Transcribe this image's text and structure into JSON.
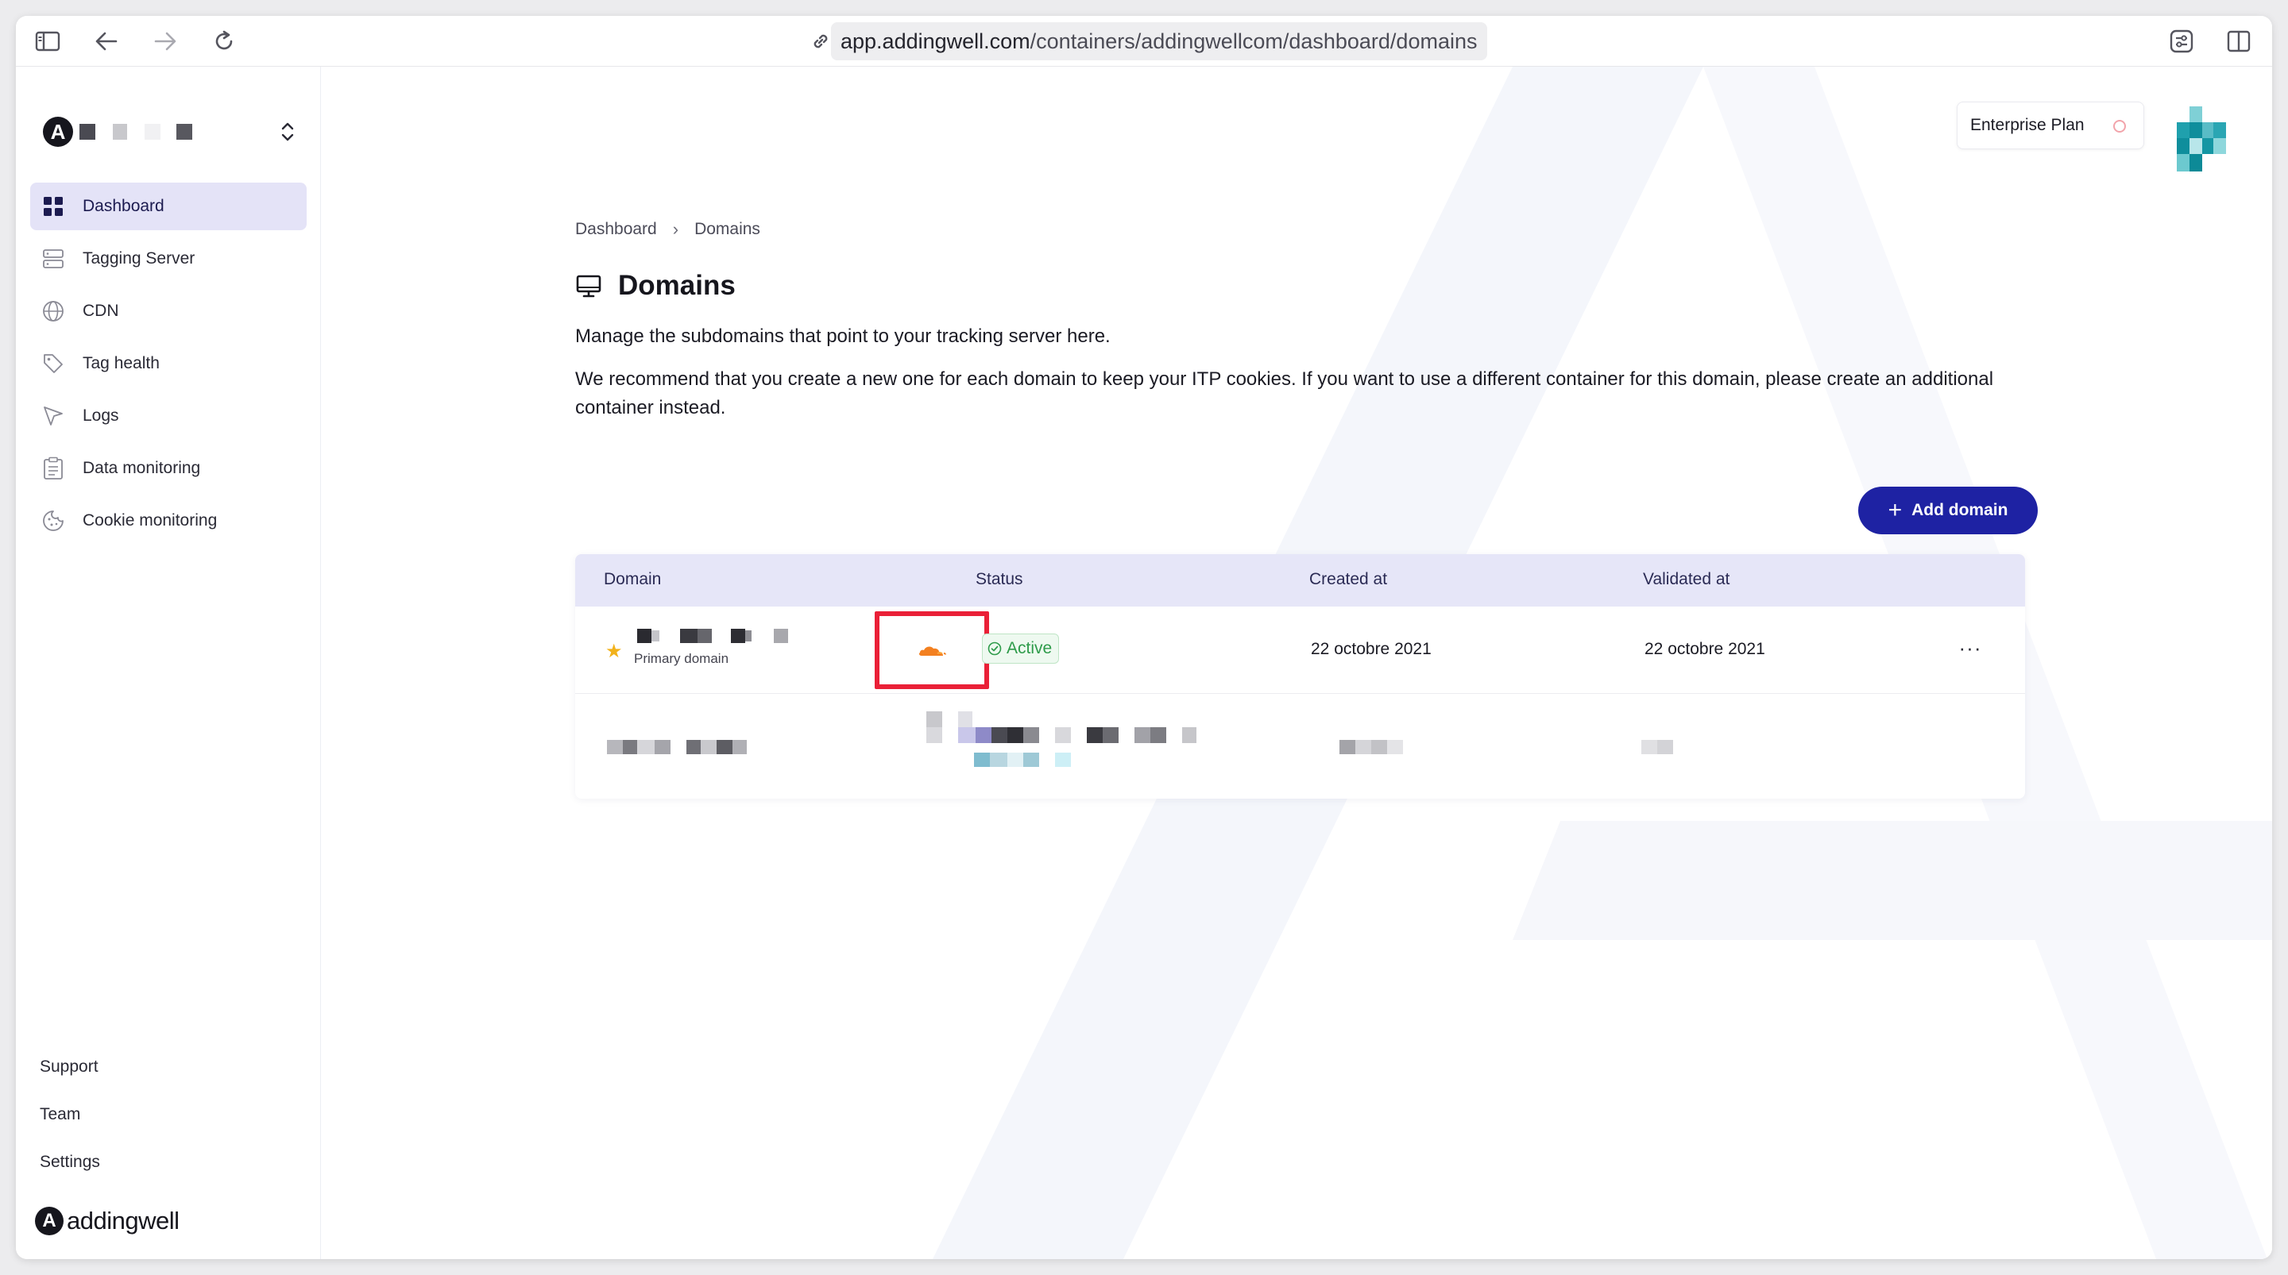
{
  "browser": {
    "url_host": "app.addingwell.com",
    "url_path": "/containers/addingwellcom/dashboard/domains"
  },
  "sidebar": {
    "items": [
      {
        "label": "Dashboard",
        "icon": "dashboard-grid-icon",
        "active": true
      },
      {
        "label": "Tagging Server",
        "icon": "server-icon",
        "active": false
      },
      {
        "label": "CDN",
        "icon": "globe-icon",
        "active": false
      },
      {
        "label": "Tag health",
        "icon": "tag-icon",
        "active": false
      },
      {
        "label": "Logs",
        "icon": "cursor-arrow-icon",
        "active": false
      },
      {
        "label": "Data monitoring",
        "icon": "clipboard-icon",
        "active": false
      },
      {
        "label": "Cookie monitoring",
        "icon": "cookie-icon",
        "active": false
      }
    ],
    "bottom_links": [
      "Support",
      "Team",
      "Settings"
    ],
    "brand": "addingwell"
  },
  "header": {
    "plan": "Enterprise Plan"
  },
  "breadcrumb": {
    "items": [
      "Dashboard",
      "Domains"
    ],
    "separator": "›"
  },
  "page": {
    "title": "Domains",
    "description_1": "Manage the subdomains that point to your tracking server here.",
    "description_2": "We recommend that you create a new one for each domain to keep your ITP cookies. If you want to use a different container for this domain, please create an additional container instead.",
    "add_button": "Add domain"
  },
  "table": {
    "headers": [
      "Domain",
      "Status",
      "Created at",
      "Validated at"
    ],
    "rows": [
      {
        "primary_label": "Primary domain",
        "status": "Active",
        "created_at": "22 octobre 2021",
        "validated_at": "22 octobre 2021",
        "more": "···"
      }
    ]
  },
  "colors": {
    "accent": "#1e22a3",
    "active_nav_bg": "#e4e3f7",
    "table_header_bg": "#e6e6f8",
    "status_green": "#2e9b4a",
    "highlight_red": "#ea2037",
    "cloudflare_orange": "#f38020"
  }
}
